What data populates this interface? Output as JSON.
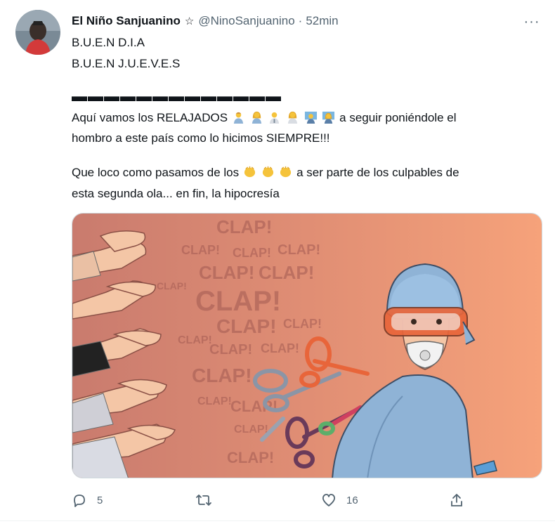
{
  "tweet": {
    "display_name": "El Niño Sanjuanino",
    "badge": "☆",
    "handle": "@NinoSanjuanino",
    "separator": "·",
    "time": "52min",
    "more": "···",
    "lines": {
      "l1": "B.U.E.N D.I.A",
      "l2": "B.U.E.N J.U.E.V.E.S",
      "l3": "▬▬▬▬▬▬▬▬▬▬▬▬▬",
      "l4_a": "Aquí vamos los RELAJADOS ",
      "l4_b": " a seguir poniéndole el",
      "l5": "hombro a este país  como lo hicimos SIEMPRE!!!",
      "l6_a": "Que loco como pasamos de los ",
      "l6_b": " a ser parte de los culpables de",
      "l7": "esta segunda ola... en fin, la hipocresía"
    },
    "emojis_l4": [
      "man-health-worker-emoji",
      "woman-health-worker-emoji",
      "health-worker-emoji",
      "woman-health-worker-emoji",
      "teacher-emoji",
      "woman-teacher-emoji"
    ],
    "emojis_l6": [
      "clapping-hands-emoji",
      "clapping-hands-emoji",
      "clapping-hands-emoji"
    ],
    "media": {
      "clap_text": "CLAP!"
    },
    "actions": {
      "reply_count": "5",
      "retweet_count": "",
      "like_count": "16"
    }
  },
  "colors": {
    "text_primary": "#0f1419",
    "text_secondary": "#536471",
    "media_bg_left": "#c97b6e",
    "media_bg_right": "#f6a27a",
    "scrubs": "#8fb3d6",
    "goggles": "#e8653a",
    "clap_emoji": "#f5c33b"
  }
}
